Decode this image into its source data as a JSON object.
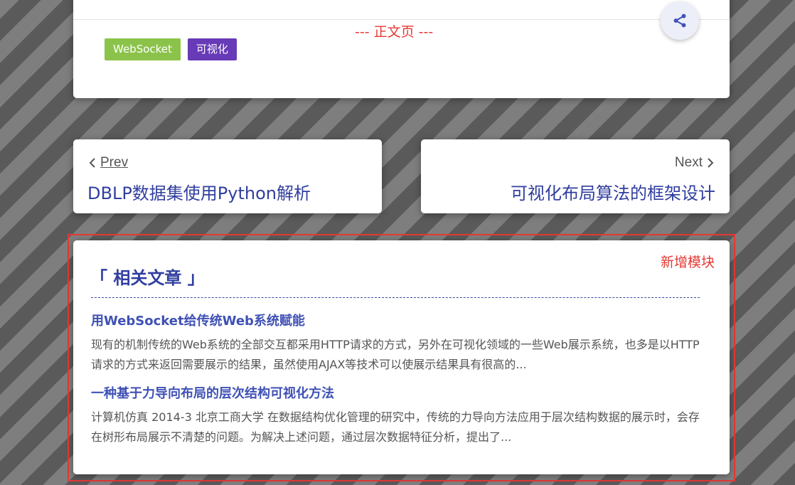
{
  "article": {
    "page_marker": "--- 正文页 ---",
    "tags": [
      {
        "label": "WebSocket",
        "color": "#8bc34a"
      },
      {
        "label": "可视化",
        "color": "#673ab7"
      }
    ],
    "share_icon": "share-icon"
  },
  "nav": {
    "prev_label": "Prev",
    "prev_title": "DBLP数据集使用Python解析",
    "next_label": "Next",
    "next_title": "可视化布局算法的框架设计"
  },
  "related": {
    "module_note": "新增模块",
    "heading": "「 相关文章 」",
    "items": [
      {
        "title": "用WebSocket给传统Web系统赋能",
        "desc": "现有的机制传统的Web系统的全部交互都采用HTTP请求的方式，另外在可视化领域的一些Web展示系统，也多是以HTTP请求的方式来返回需要展示的结果，虽然使用AJAX等技术可以使展示结果具有很高的..."
      },
      {
        "title": "一种基于力导向布局的层次结构可视化方法",
        "desc": "计算机仿真 2014-3 北京工商大学 在数据结构优化管理的研究中，传统的力导向方法应用于层次结构数据的展示时，会存在树形布局展示不清楚的问题。为解决上述问题，通过层次数据特征分析，提出了..."
      }
    ]
  },
  "colors": {
    "accent": "#303f9f",
    "link": "#3f51b5",
    "highlight": "#e53935",
    "tag_websocket": "#8bc34a",
    "tag_vis": "#673ab7"
  }
}
